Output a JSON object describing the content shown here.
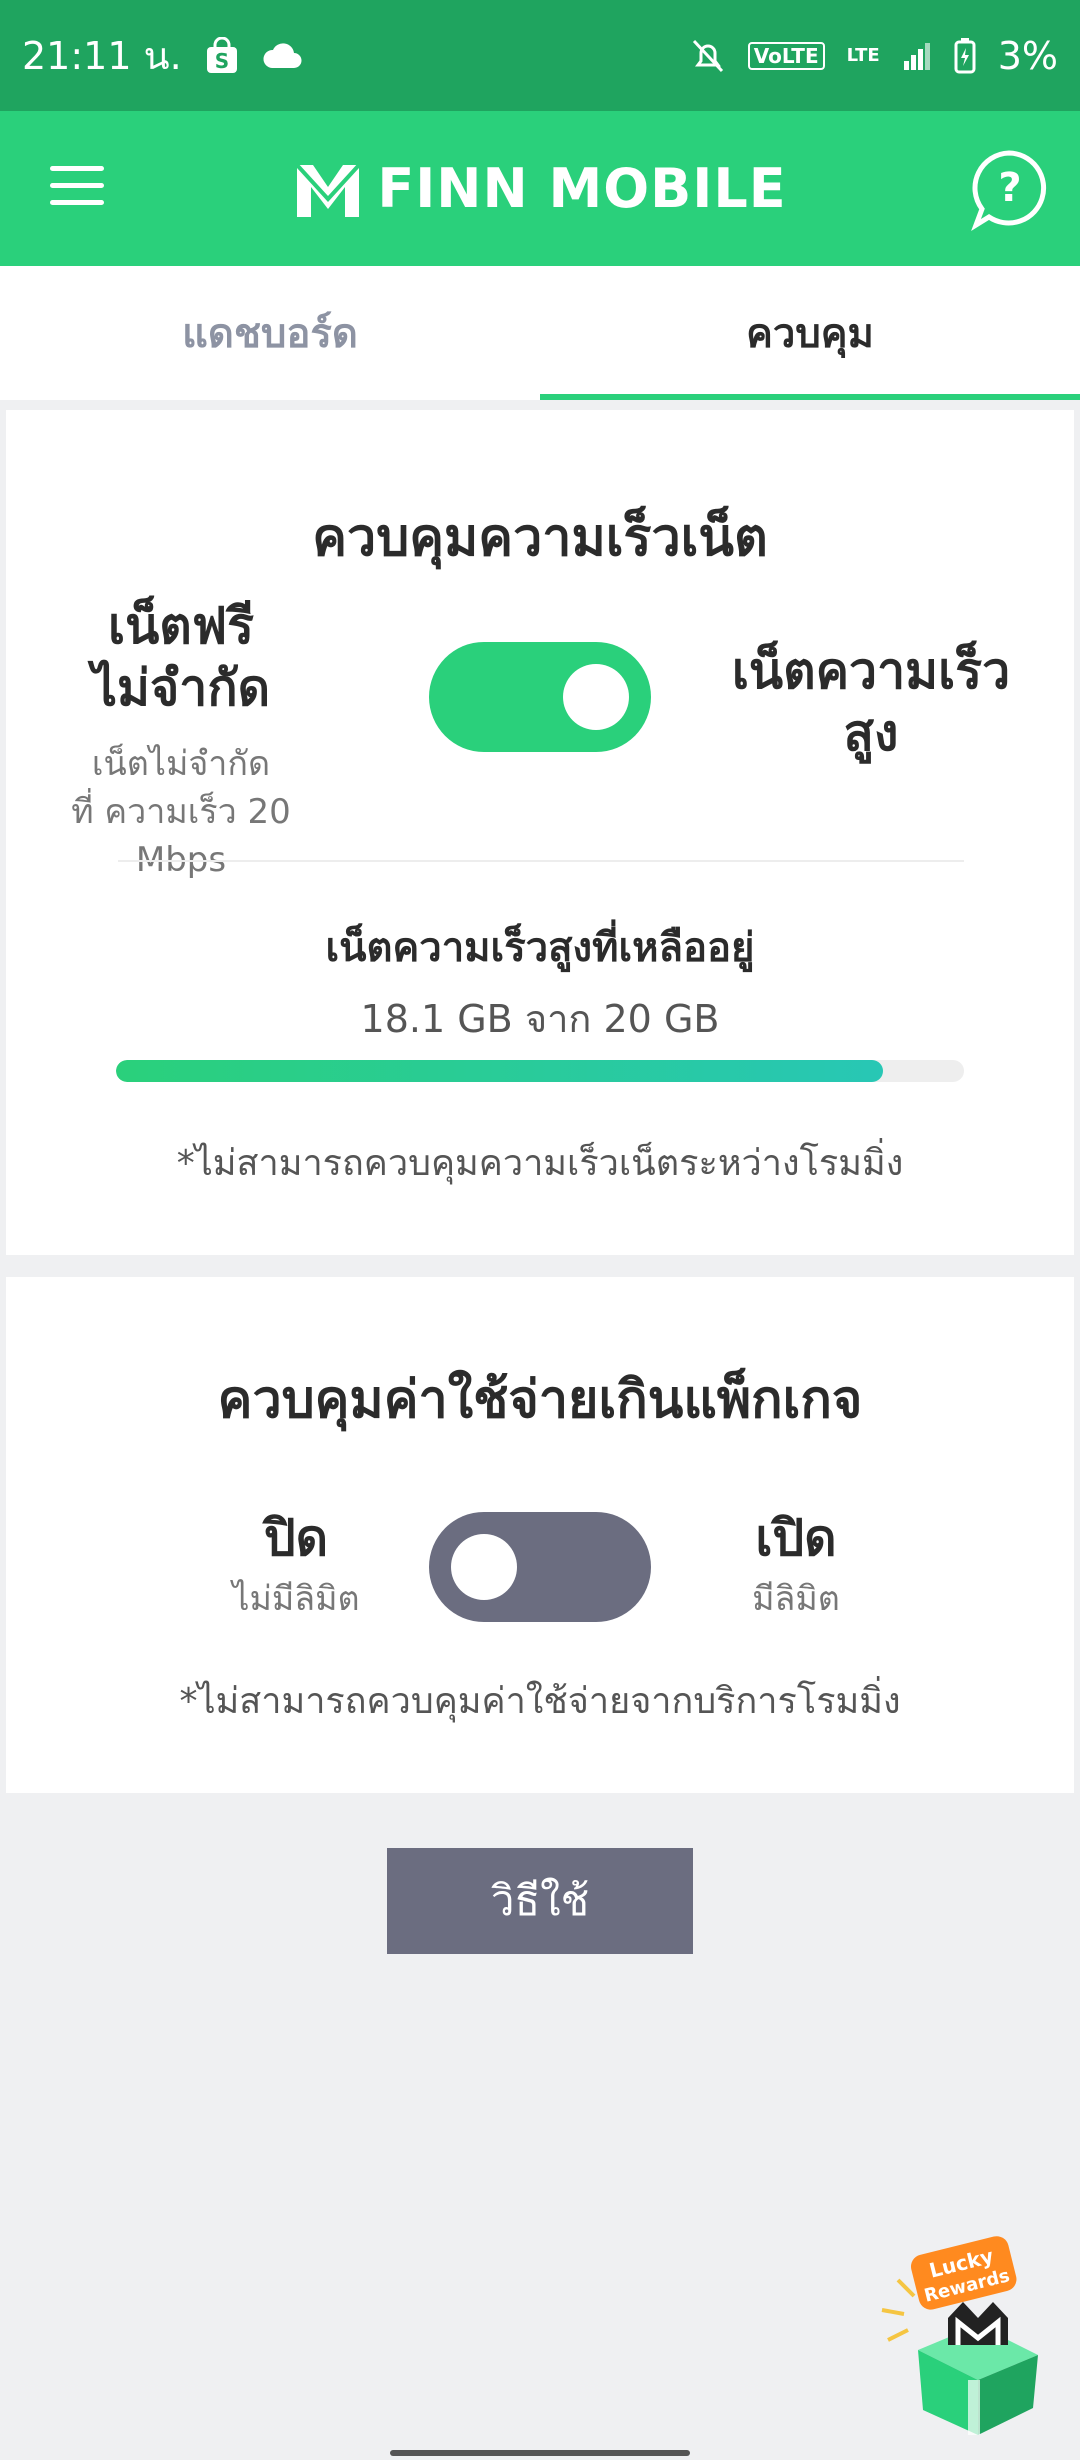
{
  "status_bar": {
    "time": "21:11 น.",
    "network_badge": "VoLTE",
    "lte": "LTE",
    "battery": "3%"
  },
  "header": {
    "brand": "FINN MOBILE"
  },
  "tabs": [
    {
      "label": "แดชบอร์ด",
      "active": false
    },
    {
      "label": "ควบคุม",
      "active": true
    }
  ],
  "speed_control": {
    "title": "ควบคุมความเร็วเน็ต",
    "left_title_line1": "เน็ตฟรี",
    "left_title_line2": "ไม่จำกัด",
    "left_sub_line1": "เน็ตไม่จำกัด",
    "left_sub_line2": "ที่ ความเร็ว 20",
    "left_sub_line3": "Mbps",
    "right_title_line1": "เน็ตความเร็ว",
    "right_title_line2": "สูง",
    "toggle_on": true,
    "remaining_label": "เน็ตความเร็วสูงที่เหลืออยู่",
    "remaining_value": "18.1 GB จาก 20 GB",
    "remaining_fraction": 0.905,
    "note": "*ไม่สามารถควบคุมความเร็วเน็ตระหว่างโรมมิ่ง"
  },
  "overage_control": {
    "title": "ควบคุมค่าใช้จ่ายเกินแพ็กเกจ",
    "left_title": "ปิด",
    "left_sub": "ไม่มีลิมิต",
    "right_title": "เปิด",
    "right_sub": "มีลิมิต",
    "toggle_on": false,
    "note": "*ไม่สามารถควบคุมค่าใช้จ่ายจากบริการโรมมิ่ง"
  },
  "how_to_button": "วิธีใช้",
  "lucky_rewards": {
    "line1": "Lucky",
    "line2": "Rewards"
  },
  "colors": {
    "status_bar": "#1fa45f",
    "brand_green": "#2ad07b",
    "toggle_off": "#6b6d80",
    "background": "#eff0f2"
  }
}
